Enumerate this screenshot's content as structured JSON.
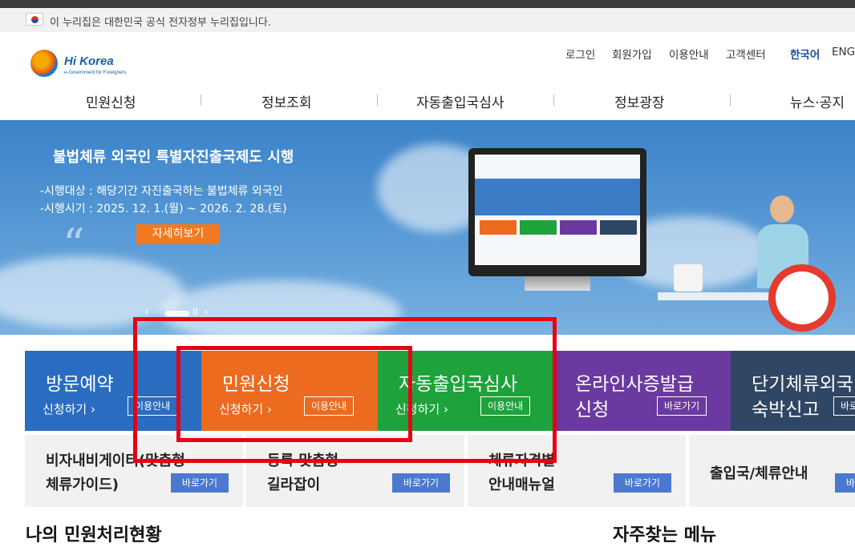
{
  "gov_notice": "이 누리집은 대한민국 공식 전자정부 누리집입니다.",
  "logo": {
    "name": "Hi Korea",
    "sub": "e-Government for Foreigners"
  },
  "util_menu": [
    "로그인",
    "회원가입",
    "이용안내",
    "고객센터"
  ],
  "lang": {
    "ko": "한국어",
    "en": "ENG"
  },
  "gnb": [
    "민원신청",
    "정보조회",
    "자동출입국심사",
    "정보광장",
    "뉴스·공지"
  ],
  "banner": {
    "title": "불법체류 외국인 특별자진출국제도 시행",
    "line1": "-시행대상 : 해당기간 자진출국하는 불법체류 외국인",
    "line2": "-시행시기 : 2025. 12. 1.(월) ~ 2026. 2. 28.(토)",
    "more": "자세히보기",
    "quote": "“",
    "pager_prev": "‹",
    "pager_pause": "II",
    "pager_next": "›"
  },
  "tiles": [
    {
      "title": "방문예약",
      "go": "신청하기 ›",
      "btn": "이용안내",
      "color": "#2a6cc0"
    },
    {
      "title": "민원신청",
      "go": "신청하기 ›",
      "btn": "이용안내",
      "color": "#ec6b1f"
    },
    {
      "title": "자동출입국심사",
      "go": "신청하기 ›",
      "btn": "이용안내",
      "color": "#1ea33c"
    },
    {
      "title": "온라인사증발급",
      "title2": "신청",
      "btn": "바로가기",
      "color": "#6b3aa0"
    },
    {
      "title": "단기체류외국",
      "title2": "숙박신고",
      "btn": "바로가기",
      "color": "#2f4664"
    }
  ],
  "guides": [
    {
      "line1": "비자내비게이터(맞춤형",
      "line2": "체류가이드)",
      "btn": "바로가기"
    },
    {
      "line1": "등록 맞춤형",
      "line2": "길라잡이",
      "btn": "바로가기"
    },
    {
      "line1": "체류자격별",
      "line2": "안내매뉴얼",
      "btn": "바로가기"
    },
    {
      "line1": "출입국/체류안내",
      "line2": "",
      "btn": "바로가기"
    }
  ],
  "sections": {
    "my_status": "나의 민원처리현황",
    "faq_menu": "자주찾는 메뉴"
  },
  "colors": {
    "highlight": "#e60012",
    "button_blue": "#4b79cf",
    "more_orange": "#f07a22"
  }
}
